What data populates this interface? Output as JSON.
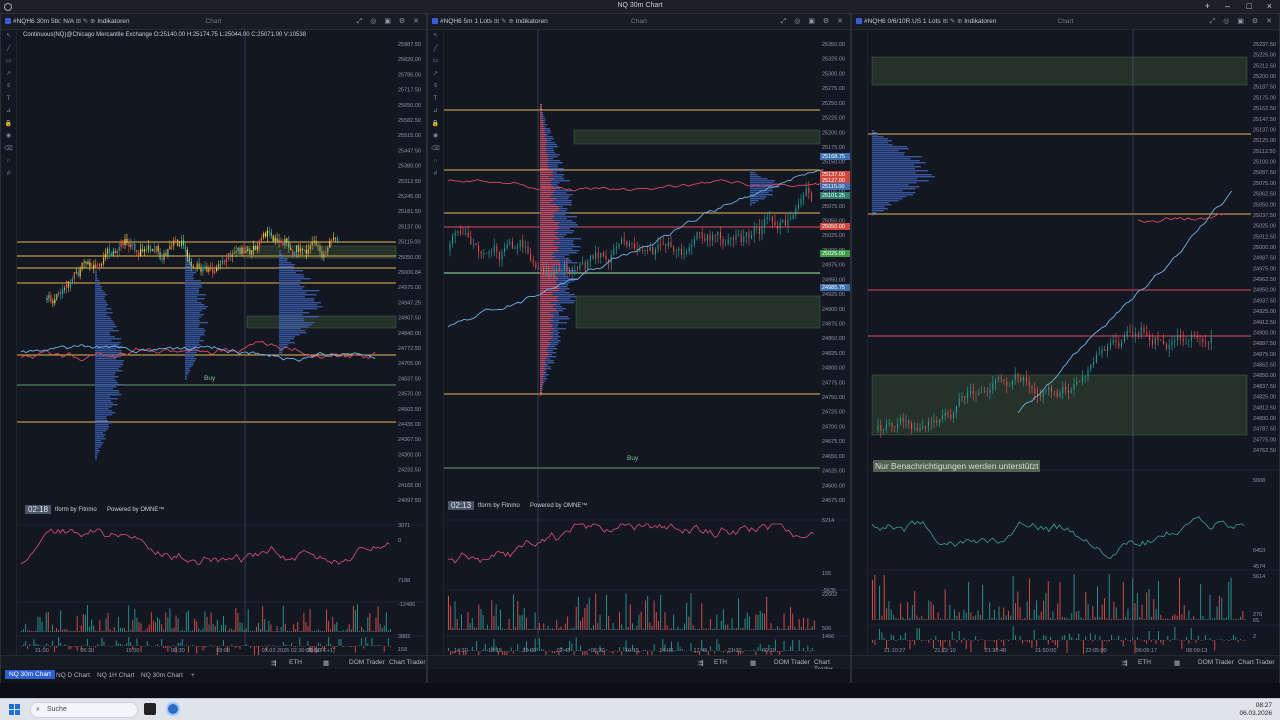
{
  "app": {
    "title": "NQ 30m Chart"
  },
  "panels": [
    {
      "symbol": "#NQH6",
      "interval": "30m",
      "extra": "5tk: N/A",
      "indicators_label": "Indikatoren",
      "panel_label": "Chart",
      "info_line": "Continuous(NQ)@Chicago Mercantile Exchange O:25140.00 H:25174.75 L:25044.00 C:25071.00 V:10538",
      "price_labels": [
        "25887.50",
        "25820.00",
        "25785.00",
        "25717.50",
        "25650.00",
        "25582.50",
        "25515.00",
        "25447.50",
        "25380.00",
        "25312.50",
        "25245.00",
        "25181.50",
        "25137.00",
        "25115.00",
        "25050.00",
        "25006.84",
        "24975.00",
        "24947.25",
        "24907.50",
        "24840.00",
        "24772.50",
        "24705.00",
        "24637.50",
        "24570.00",
        "24502.50",
        "24435.00",
        "24367.50",
        "24300.00",
        "24232.50",
        "24165.00",
        "24097.50"
      ],
      "sub_labels": [
        "3071",
        "0",
        "-12486",
        "7188",
        "3882",
        "158",
        "-2864"
      ],
      "time_labels": [
        "21:00",
        "06:30",
        "15:00",
        "00:30",
        "09:00",
        "05.03.2026 02:30:00 (UTC+1)",
        "20:00"
      ],
      "timer": "02:18",
      "buy_label": "Buy",
      "watermark": "tform by Fitnmo",
      "powered": "Powered by OMNE™",
      "session": "ETH",
      "bottom_right": [
        "DOM Trader",
        "Chart Trader"
      ]
    },
    {
      "symbol": "#NQH6",
      "interval": "5m",
      "extra": "1 Lots",
      "indicators_label": "Indikatoren",
      "panel_label": "Chart",
      "price_labels": [
        "25350.00",
        "25325.00",
        "25300.00",
        "25275.00",
        "25250.00",
        "25225.00",
        "25200.00",
        "25175.00",
        "25150.00",
        "25125.00",
        "25100.00",
        "25075.00",
        "25050.00",
        "25025.00",
        "25000.00",
        "24975.00",
        "24950.00",
        "24925.00",
        "24900.00",
        "24875.00",
        "24850.00",
        "24825.00",
        "24800.00",
        "24775.00",
        "24750.00",
        "24725.00",
        "24700.00",
        "24675.00",
        "24650.00",
        "24625.00",
        "24600.00",
        "24575.00"
      ],
      "price_badges": [
        "25168.75",
        "25137.00",
        "25127.00",
        "25115.00",
        "25101.25",
        "25050.00",
        "25025.00",
        "24985.75"
      ],
      "sub_labels": [
        "5214",
        "155",
        "-5635",
        "22002",
        "506",
        "1456",
        "57",
        "-1165"
      ],
      "time_labels": [
        "14:30",
        "18:15",
        "22:00",
        "02:45",
        "06:30",
        "10:15",
        "14:00",
        "17:45",
        "21:30",
        "06:20"
      ],
      "timer": "02:13",
      "buy_label": "Buy",
      "watermark": "tform by Fitnmo",
      "powered": "Powered by OMNE™",
      "session": "ETH",
      "bottom_right": [
        "DOM Trader",
        "Chart Trader"
      ]
    },
    {
      "symbol": "#NQH6",
      "interval": "0/6/10R.US",
      "extra": "1 Lots",
      "indicators_label": "Indikatoren",
      "panel_label": "Chart",
      "price_labels": [
        "25237.50",
        "25225.00",
        "25212.50",
        "25200.00",
        "25187.50",
        "25175.00",
        "25162.50",
        "25147.50",
        "25137.00",
        "25125.00",
        "25112.50",
        "25100.00",
        "25087.50",
        "25075.00",
        "25062.50",
        "25050.00",
        "25037.50",
        "25025.00",
        "25012.50",
        "25000.00",
        "24987.50",
        "24975.00",
        "24962.50",
        "24950.00",
        "24937.50",
        "24925.00",
        "24912.50",
        "24900.00",
        "24887.50",
        "24875.00",
        "24862.50",
        "24850.00",
        "24837.50",
        "24825.00",
        "24812.50",
        "24800.00",
        "24787.50",
        "24775.00",
        "24762.50"
      ],
      "sub_labels": [
        "5008",
        "6453",
        "4574",
        "5614",
        "276",
        "65",
        "2",
        "0"
      ],
      "time_labels": [
        "21:10:27",
        "21:22:10",
        "21:30:48",
        "21:50:00",
        "22:05:00",
        "06:06:17",
        "08:00:13"
      ],
      "notification": "Nur Benachrichtigungen werden unterstützt",
      "session": "ETH",
      "bottom_right": [
        "DOM Trader",
        "Chart Trader"
      ]
    }
  ],
  "tabs": [
    "NQ 30m Chart",
    "NQ D Chart",
    "NQ 1H Chart",
    "NQ 30m Chart"
  ],
  "taskbar": {
    "search_placeholder": "Suche",
    "time": "08:27",
    "date": "06.03.2026"
  },
  "colors": {
    "accent": "#2d5fd1",
    "up": "#26a69a",
    "down": "#ef5350",
    "level": "#e8b454",
    "volume_profile": "#3f63b8"
  }
}
